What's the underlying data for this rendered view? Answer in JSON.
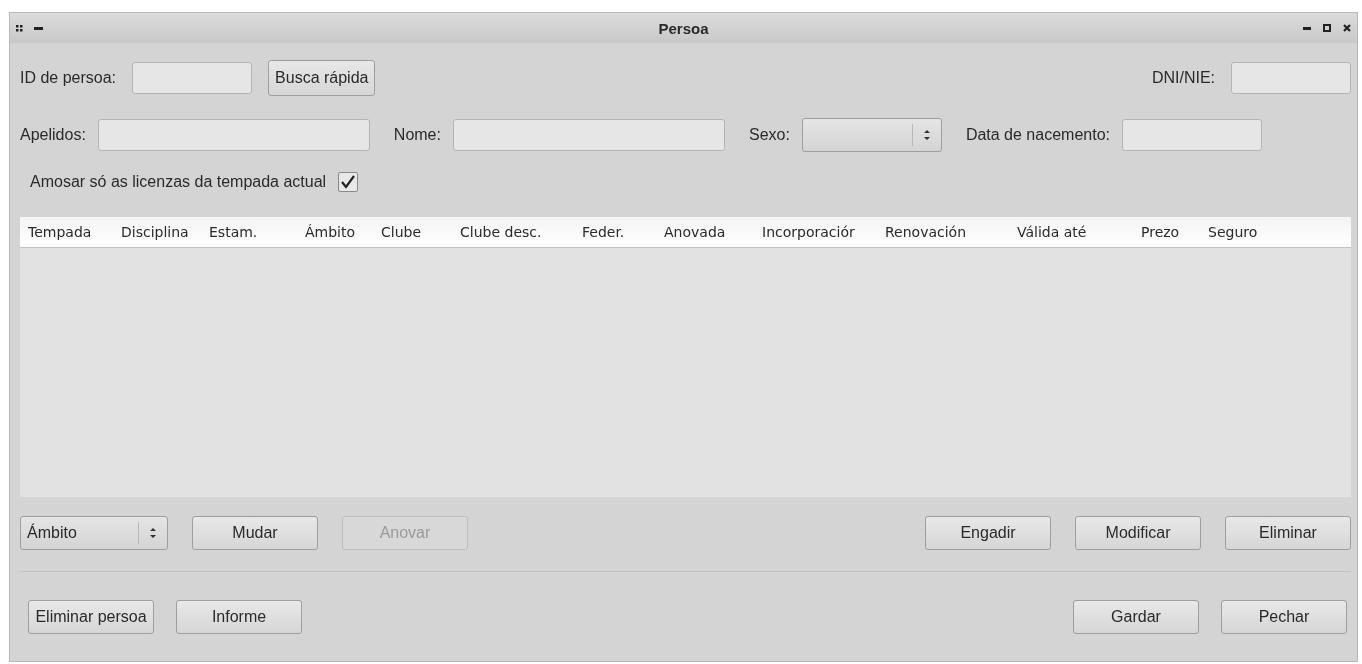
{
  "window": {
    "title": "Persoa"
  },
  "person_id": {
    "label": "ID de persoa:",
    "button": "Busca rápida"
  },
  "dni": {
    "label": "DNI/NIE:"
  },
  "surname": {
    "label": "Apelidos:"
  },
  "name": {
    "label": "Nome:"
  },
  "sex": {
    "label": "Sexo:"
  },
  "birth_date": {
    "label": "Data de nacemento:"
  },
  "current_season_only": {
    "label": "Amosar só as licenzas da tempada actual",
    "checked": true
  },
  "table": {
    "columns": [
      {
        "label": "Tempada"
      },
      {
        "label": "Disciplina"
      },
      {
        "label": "Estam."
      },
      {
        "label": "Ámbito"
      },
      {
        "label": "Clube"
      },
      {
        "label": "Clube desc."
      },
      {
        "label": "Feder."
      },
      {
        "label": "Anovada"
      },
      {
        "label": "Incorporaciór"
      },
      {
        "label": "Renovación"
      },
      {
        "label": "Válida até"
      },
      {
        "label": "Prezo"
      },
      {
        "label": "Seguro"
      }
    ]
  },
  "scope_select": {
    "value": "Ámbito"
  },
  "license_buttons_left": [
    {
      "label": "Mudar",
      "disabled": false
    },
    {
      "label": "Anovar",
      "disabled": true
    }
  ],
  "license_buttons_right": [
    {
      "label": "Engadir",
      "disabled": false
    },
    {
      "label": "Modificar",
      "disabled": false
    },
    {
      "label": "Eliminar",
      "disabled": false
    }
  ],
  "footer_buttons_left": [
    {
      "label": "Eliminar persoa"
    },
    {
      "label": "Informe"
    }
  ],
  "footer_buttons_right": [
    {
      "label": "Gardar"
    },
    {
      "label": "Pechar"
    }
  ]
}
